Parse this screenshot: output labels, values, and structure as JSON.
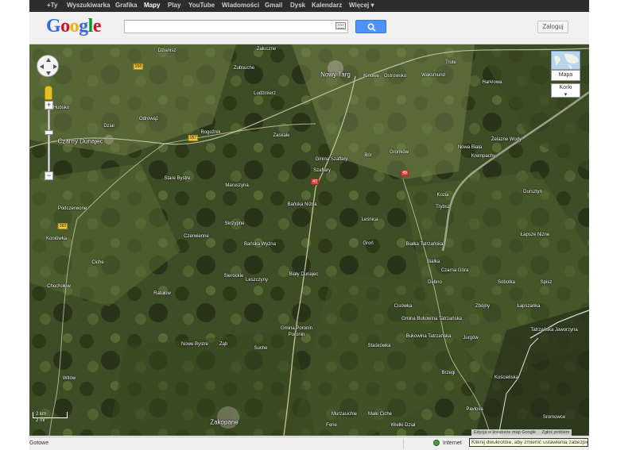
{
  "topbar": {
    "items": [
      {
        "label": "+Ty"
      },
      {
        "label": "Wyszukiwarka"
      },
      {
        "label": "Grafika"
      },
      {
        "label": "Mapy",
        "active": true
      },
      {
        "label": "Play"
      },
      {
        "label": "YouTube"
      },
      {
        "label": "Wiadomości"
      },
      {
        "label": "Gmail"
      },
      {
        "label": "Dysk"
      },
      {
        "label": "Kalendarz"
      },
      {
        "label": "Więcej ▾"
      }
    ]
  },
  "header": {
    "logo_letters": [
      "G",
      "o",
      "o",
      "g",
      "l",
      "e"
    ],
    "logo_colors": [
      "#3369e8",
      "#d50f25",
      "#eeb211",
      "#3369e8",
      "#009925",
      "#d50f25"
    ],
    "search_value": "",
    "login_label": "Zaloguj",
    "search_button_color": "#4d90fe"
  },
  "map": {
    "view": "satellite",
    "map_type_label": "Mapa",
    "traffic_label": "Korki",
    "traffic_arrow": "▾",
    "zoom_in_label": "+",
    "zoom_out_label": "−",
    "scale_km": "2 km",
    "scale_mi": "2 mi",
    "places": [
      {
        "name": "Nowy Targ",
        "big": true
      },
      {
        "name": "Czarny Dunajec",
        "big": true
      },
      {
        "name": "Zakopane",
        "big": true
      },
      {
        "name": "Gmina Szaflary"
      },
      {
        "name": "Szaflary"
      },
      {
        "name": "Biały Dunajec"
      },
      {
        "name": "Gmina Poronin"
      },
      {
        "name": "Poronin"
      },
      {
        "name": "Bańska Niżna"
      },
      {
        "name": "Bańska Wyżna"
      },
      {
        "name": "Białka Tatrzańska"
      },
      {
        "name": "Gmina Bukowina Tatrzańska"
      },
      {
        "name": "Bukowina Tatrzańska"
      },
      {
        "name": "Czarna Góra"
      },
      {
        "name": "Trybsz"
      },
      {
        "name": "Łapsze Niżne"
      },
      {
        "name": "Łapszanka"
      },
      {
        "name": "Nowa Biała"
      },
      {
        "name": "Krempachy"
      },
      {
        "name": "Dursztyn"
      },
      {
        "name": "Rogoźnik"
      },
      {
        "name": "Ludźmierz"
      },
      {
        "name": "Zaskale"
      },
      {
        "name": "Maruszyna"
      },
      {
        "name": "Skrzypne"
      },
      {
        "name": "Stare Bystre"
      },
      {
        "name": "Czerwienne"
      },
      {
        "name": "Leszczyny"
      },
      {
        "name": "Sierockie"
      },
      {
        "name": "Ratułów"
      },
      {
        "name": "Nowe Bystre"
      },
      {
        "name": "Ząb"
      },
      {
        "name": "Suche"
      },
      {
        "name": "Murzasichle"
      },
      {
        "name": "Małe Ciche"
      },
      {
        "name": "Brzegi"
      },
      {
        "name": "Jurgów"
      },
      {
        "name": "Gronków"
      },
      {
        "name": "Bór"
      },
      {
        "name": "Groń"
      },
      {
        "name": "Leśnica"
      },
      {
        "name": "Bialka"
      },
      {
        "name": "Witów"
      },
      {
        "name": "Chochołów"
      },
      {
        "name": "Koniówka"
      },
      {
        "name": "Ciche"
      },
      {
        "name": "Podczerwone"
      },
      {
        "name": "Dzianisz"
      },
      {
        "name": "Odrowąż"
      },
      {
        "name": "Załuczne"
      },
      {
        "name": "Ostrowsko"
      },
      {
        "name": "Waksmund"
      },
      {
        "name": "Harklowa"
      },
      {
        "name": "Dzial"
      },
      {
        "name": "Trute"
      },
      {
        "name": "Zubsuche"
      },
      {
        "name": "Hubsko"
      },
      {
        "name": "Żelazne Wody"
      },
      {
        "name": "Cisówka"
      },
      {
        "name": "Dębno"
      },
      {
        "name": "Zbójny"
      },
      {
        "name": "Sobotka"
      },
      {
        "name": "Kinowe"
      },
      {
        "name": "Kozia"
      },
      {
        "name": "Staśkówka"
      },
      {
        "name": "Sromowce"
      },
      {
        "name": "Tatrzańska Jaworzyna"
      },
      {
        "name": "Pavlova"
      },
      {
        "name": "Wielki Dział"
      },
      {
        "name": "Spisz"
      },
      {
        "name": "Ferie"
      },
      {
        "name": "Kościeliska"
      }
    ],
    "roads": [
      {
        "label": "958",
        "color": "yellow"
      },
      {
        "label": "957",
        "color": "yellow"
      },
      {
        "label": "47",
        "color": "red"
      },
      {
        "label": "49",
        "color": "red"
      },
      {
        "label": "960",
        "color": "yellow"
      }
    ],
    "footer_links": [
      "Edycja w kreatorze map Google",
      "Zgłoś problem"
    ]
  },
  "statusbar": {
    "status_text": "Gotowe",
    "zone_text": "Internet",
    "tooltip_text": "Kliknij dwukrotnie, aby zmienić ustawienia zabezpieczeń"
  }
}
